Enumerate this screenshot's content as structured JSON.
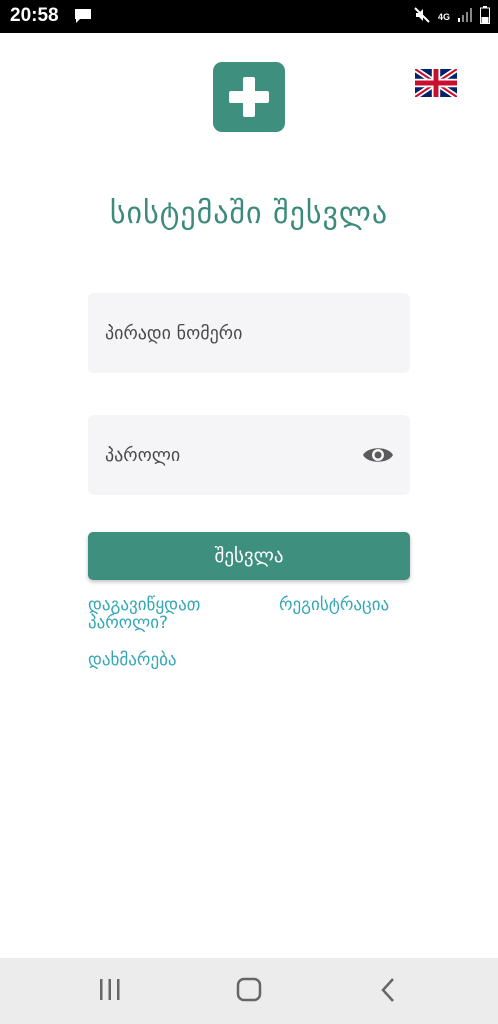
{
  "status_bar": {
    "time": "20:58",
    "message_icon": "chat-message-icon",
    "mute_icon": "mute-icon",
    "network": "4G",
    "signal_icon": "signal-icon",
    "battery_icon": "battery-icon"
  },
  "header": {
    "logo_icon": "medical-cross-icon",
    "language_flag": "uk-flag-icon"
  },
  "login": {
    "title": "სისტემაში შესვლა",
    "id_placeholder": "პირადი ნომერი",
    "password_placeholder": "პაროლი",
    "password_toggle_icon": "eye-icon",
    "submit_label": "შესვლა",
    "forgot_password": "დაგავიწყდათ პაროლი?",
    "register": "რეგისტრაცია",
    "help": "დახმარება"
  },
  "nav_bar": {
    "recents_icon": "recent-apps-icon",
    "home_icon": "home-icon",
    "back_icon": "back-icon"
  },
  "colors": {
    "primary": "#3f8f7f",
    "link": "#34a7b4",
    "field_bg": "#f5f5f7"
  }
}
